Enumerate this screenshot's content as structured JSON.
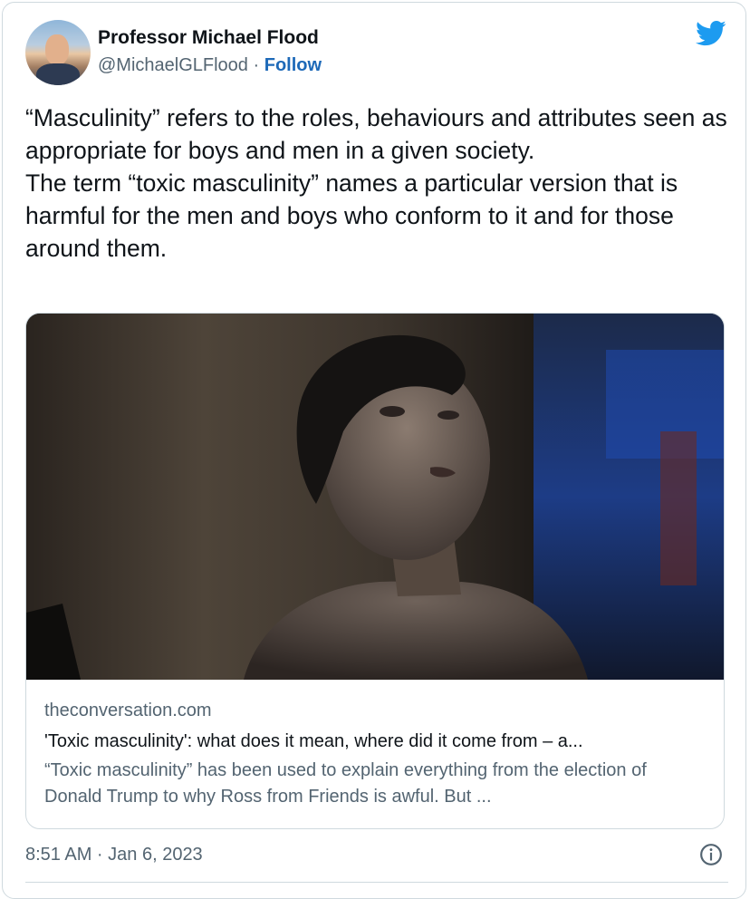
{
  "author": {
    "name": "Professor Michael Flood",
    "handle": "@MichaelGLFlood",
    "separator": "·",
    "follow_label": "Follow"
  },
  "tweet": {
    "paragraphs": [
      "“Masculinity” refers to the roles, behaviours and attributes seen as appropriate for boys and men in a given society.",
      "The term “toxic masculinity” names a particular version that is harmful for the men and boys who conform to it and for those around them."
    ]
  },
  "link_card": {
    "domain": "theconversation.com",
    "title": "'Toxic masculinity': what does it mean, where did it come from – a...",
    "description": "“Toxic masculinity” has been used to explain everything from the election of Donald Trump to why Ross from Friends is awful. But ..."
  },
  "footer": {
    "timestamp": "8:51 AM · Jan 6, 2023"
  },
  "icons": {
    "brand": "twitter-bird-icon",
    "info": "info-icon"
  },
  "colors": {
    "accent": "#1d9bf0",
    "follow": "#1d69b8",
    "text": "#0f1419",
    "secondary": "#536471",
    "border": "#cfd9de"
  }
}
